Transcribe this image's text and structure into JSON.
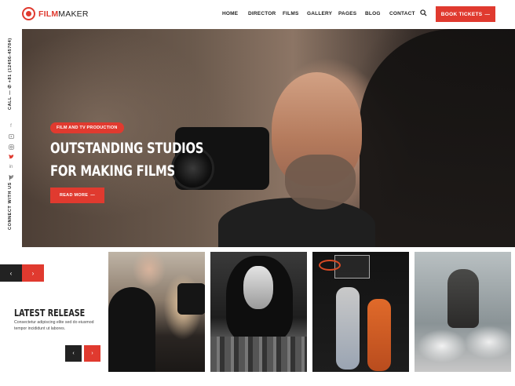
{
  "brand": {
    "part1": "FILM",
    "part2": "MAKER"
  },
  "nav": [
    "HOME",
    "DIRECTOR",
    "FILMS",
    "GALLERY",
    "PAGES",
    "BLOG",
    "CONTACT"
  ],
  "header": {
    "book_label": "BOOK TICKETS"
  },
  "sidebar": {
    "call_text": "CALL — ✆ +81 (12456-45784)",
    "connect_text": "CONNECT WITH US —",
    "socials": [
      "facebook-icon",
      "youtube-icon",
      "instagram-icon",
      "twitter-icon",
      "linkedin-icon",
      "twitter-icon"
    ]
  },
  "hero": {
    "tag": "FILM AND TV PRODUCTION",
    "title_line1": "OUTSTANDING STUDIOS",
    "title_line2": "FOR MAKING FILMS",
    "read_more": "READ MORE"
  },
  "slider": {
    "prev": "‹",
    "next": "›"
  },
  "latest": {
    "title": "LATEST RELEASE",
    "desc": "Consectetur adipiscing elite sed do eiusmod tempor incididunt ut labores."
  },
  "colors": {
    "accent": "#e03a2f",
    "dark": "#222222"
  }
}
